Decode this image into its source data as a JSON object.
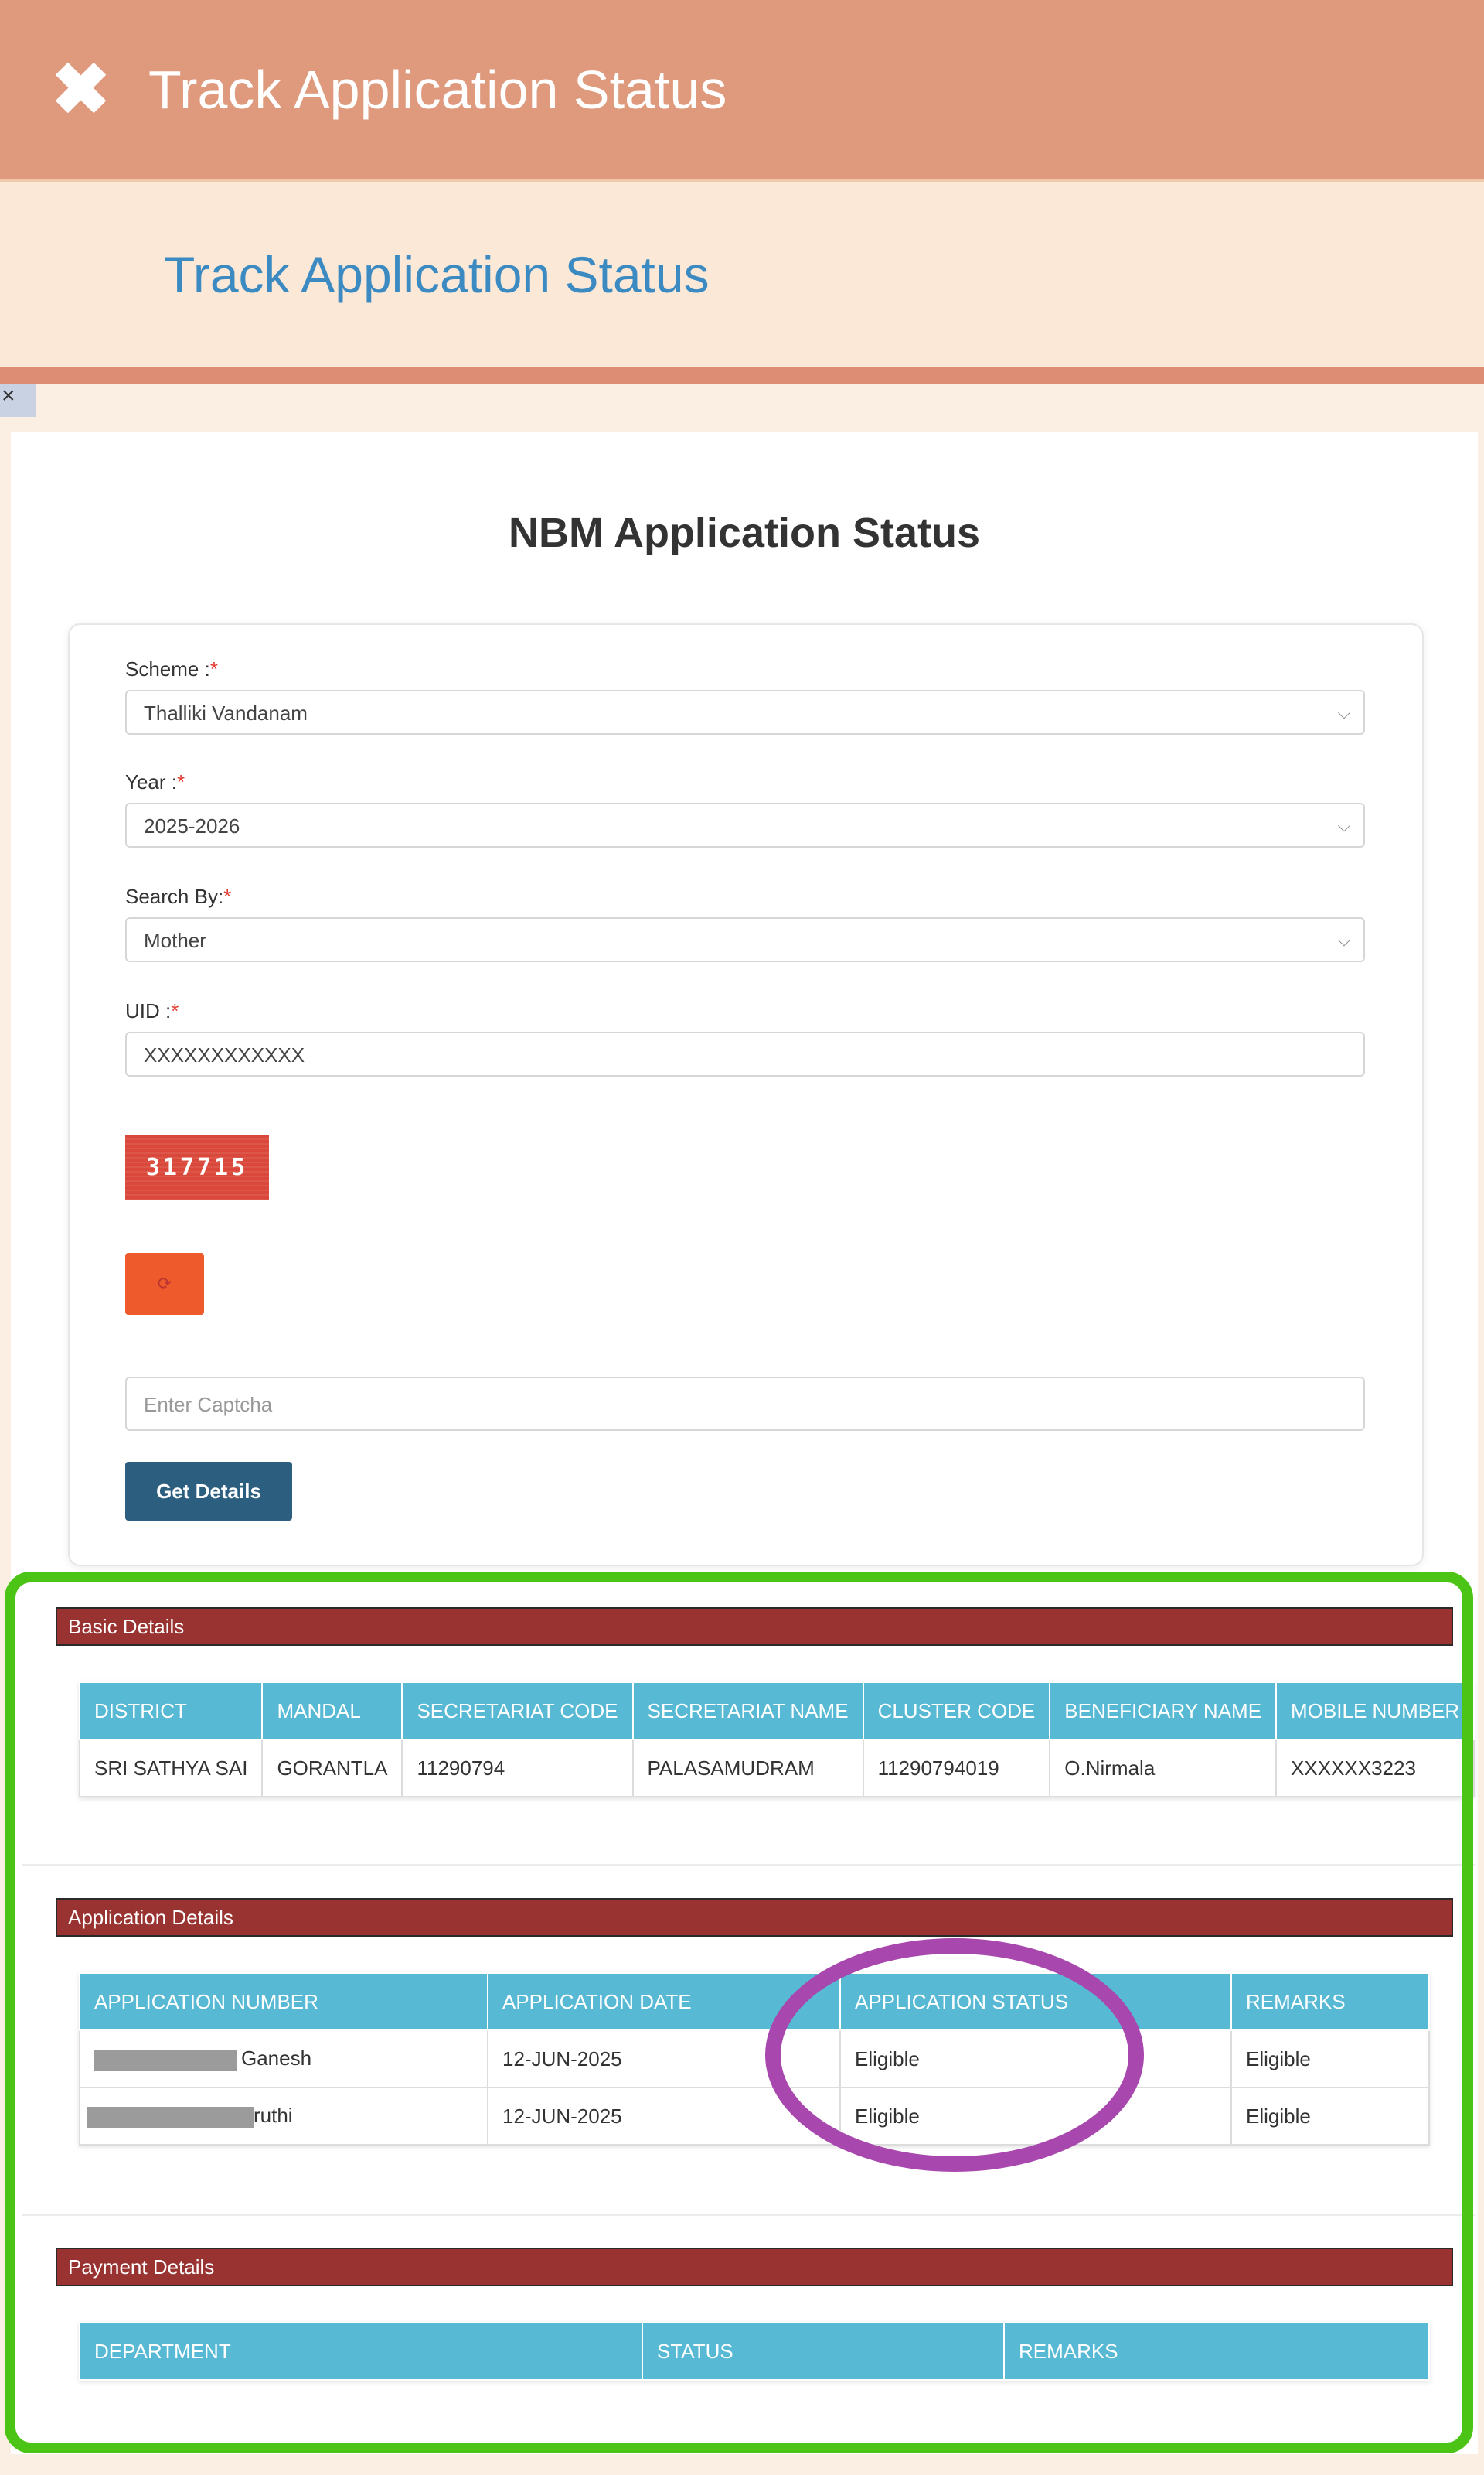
{
  "header": {
    "close_glyph": "✖",
    "title": "Track Application Status"
  },
  "subheader": {
    "title": "Track Application Status"
  },
  "mini_close": {
    "glyph": "×"
  },
  "page": {
    "heading": "NBM Application Status"
  },
  "form": {
    "scheme": {
      "label": "Scheme :",
      "required": "*",
      "value": "Thalliki Vandanam"
    },
    "year": {
      "label": "Year :",
      "required": "*",
      "value": "2025-2026"
    },
    "search_by": {
      "label": "Search By:",
      "required": "*",
      "value": "Mother"
    },
    "uid": {
      "label": "UID :",
      "required": "*",
      "value": "XXXXXXXXXXXX"
    },
    "captcha_code": "317715",
    "refresh_glyph": "⟳",
    "captcha_placeholder": "Enter Captcha",
    "get_details_label": "Get Details"
  },
  "basic_details": {
    "header": "Basic Details",
    "columns": [
      "DISTRICT",
      "MANDAL",
      "SECRETARIAT CODE",
      "SECRETARIAT NAME",
      "CLUSTER CODE",
      "BENEFICIARY NAME",
      "MOBILE NUMBER"
    ],
    "rows": [
      [
        "SRI SATHYA SAI",
        "GORANTLA",
        "11290794",
        "PALASAMUDRAM",
        "11290794019",
        "O.Nirmala",
        "XXXXXX3223"
      ]
    ]
  },
  "application_details": {
    "header": "Application Details",
    "columns": [
      "APPLICATION NUMBER",
      "APPLICATION DATE",
      "APPLICATION STATUS",
      "REMARKS"
    ],
    "rows": [
      [
        "Ganesh",
        "12-JUN-2025",
        "Eligible",
        "Eligible"
      ],
      [
        "ruthi",
        "12-JUN-2025",
        "Eligible",
        "Eligible"
      ]
    ]
  },
  "payment_details": {
    "header": "Payment Details",
    "columns": [
      "DEPARTMENT",
      "STATUS",
      "REMARKS"
    ]
  },
  "colors": {
    "topbar": "#df9a7e",
    "section_header": "#993331",
    "table_header": "#58b9d4",
    "highlight_green": "#4cc415",
    "highlight_purple": "#a847ad",
    "button": "#2c5f7f"
  }
}
